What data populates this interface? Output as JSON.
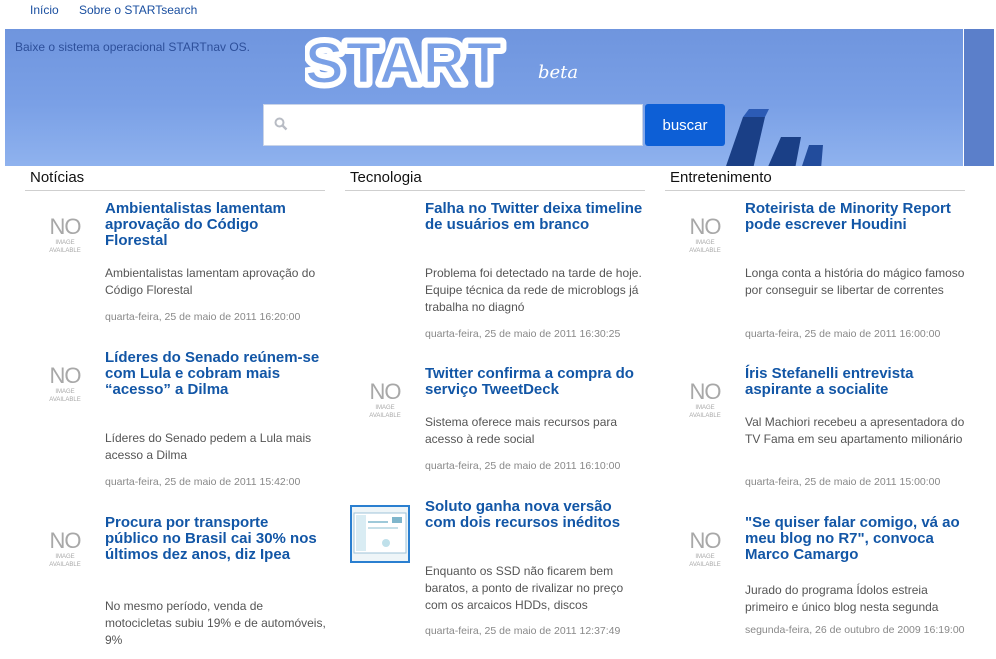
{
  "nav": {
    "home": "Início",
    "about": "Sobre o STARTsearch"
  },
  "hero": {
    "download": "Baixe o sistema operacional STARTnav OS.",
    "logo": "START",
    "beta": "beta"
  },
  "search": {
    "placeholder": "",
    "button": "buscar"
  },
  "columns": [
    {
      "heading": "Notícias",
      "items": [
        {
          "title": "Ambientalistas lamentam aprovação do Código Florestal",
          "desc": "Ambientalistas lamentam aprovação do Código Florestal",
          "date": "quarta-feira, 25 de maio de 2011 16:20:00"
        },
        {
          "title": "Líderes do Senado reúnem-se com Lula e cobram mais “acesso” a Dilma",
          "desc": "Líderes do Senado pedem a Lula mais acesso a Dilma",
          "date": "quarta-feira, 25 de maio de 2011 15:42:00"
        },
        {
          "title": "Procura por transporte público no Brasil cai 30% nos últimos dez anos, diz Ipea",
          "desc": "No mesmo período, venda de motocicletas subiu 19% e de automóveis, 9%",
          "date": ""
        }
      ]
    },
    {
      "heading": "Tecnologia",
      "items": [
        {
          "title": "Falha no Twitter deixa timeline de usuários em branco",
          "desc": "Problema foi detectado na tarde de hoje. Equipe técnica da rede de microblogs já trabalha no diagnó",
          "date": "quarta-feira, 25 de maio de 2011 16:30:25"
        },
        {
          "title": "Twitter confirma a compra do serviço TweetDeck",
          "desc": "Sistema oferece mais recursos para acesso à rede social",
          "date": "quarta-feira, 25 de maio de 2011 16:10:00"
        },
        {
          "title": "Soluto ganha nova versão com dois recursos inéditos",
          "desc": "Enquanto os SSD não ficarem bem baratos, a ponto de rivalizar no preço com os arcaicos HDDs, discos",
          "date": "quarta-feira, 25 de maio de 2011 12:37:49"
        }
      ]
    },
    {
      "heading": "Entretenimento",
      "items": [
        {
          "title": "Roteirista de Minority Report pode escrever Houdini",
          "desc": "Longa conta a história do mágico famoso por conseguir se libertar de correntes",
          "date": "quarta-feira, 25 de maio de 2011 16:00:00"
        },
        {
          "title": "Íris Stefanelli entrevista aspirante a socialite",
          "desc": "Val Machiori recebeu a apresentadora do TV Fama em seu apartamento milionário",
          "date": "quarta-feira, 25 de maio de 2011 15:00:00"
        },
        {
          "title": "\"Se quiser falar comigo, vá ao meu blog no R7\", convoca Marco Camargo",
          "desc": "Jurado do programa Ídolos estreia primeiro e único blog nesta segunda",
          "date": "segunda-feira, 26 de outubro de 2009 16:19:00"
        }
      ]
    }
  ],
  "thumb": {
    "no": "NO",
    "image": "IMAGE",
    "available": "AVAILABLE"
  },
  "colors": {
    "link": "#1256a6",
    "button": "#0d5fd6",
    "hero": "#7aa0e6"
  }
}
